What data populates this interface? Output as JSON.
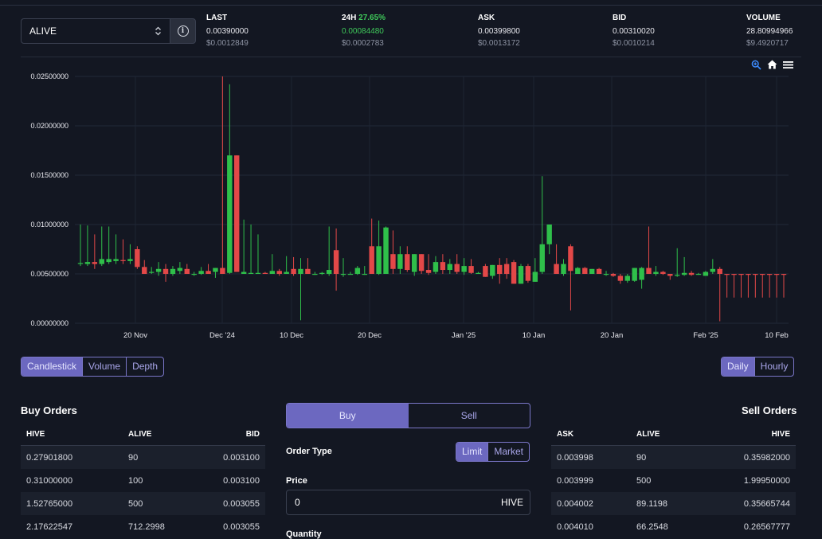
{
  "market": {
    "selected": "ALIVE"
  },
  "stats": {
    "last": {
      "label": "LAST",
      "value": "0.00390000",
      "usd": "$0.0012849"
    },
    "change": {
      "label": "24H",
      "percent": "27.65%",
      "value": "0.00084480",
      "usd": "$0.0002783"
    },
    "ask": {
      "label": "ASK",
      "value": "0.00399800",
      "usd": "$0.0013172"
    },
    "bid": {
      "label": "BID",
      "value": "0.00310020",
      "usd": "$0.0010214"
    },
    "volume": {
      "label": "VOLUME",
      "value": "28.80994966",
      "usd": "$9.4920717"
    }
  },
  "chart_tools": [
    "zoom-icon",
    "home-icon",
    "menu-icon"
  ],
  "chart_data": {
    "type": "candlestick",
    "y_ticks": [
      "0.02500000",
      "0.02000000",
      "0.01500000",
      "0.01000000",
      "0.00500000",
      "0.00000000"
    ],
    "ylim": [
      0,
      0.025
    ],
    "x_ticks": [
      "20 Nov",
      "Dec '24",
      "10 Dec",
      "20 Dec",
      "Jan '25",
      "10 Jan",
      "20 Jan",
      "Feb '25",
      "10 Feb"
    ],
    "up_color": "#2fbf4a",
    "down_color": "#e34848",
    "candles": [
      {
        "o": 0.0061,
        "h": 0.01,
        "l": 0.0058,
        "c": 0.0061
      },
      {
        "o": 0.006,
        "h": 0.0099,
        "l": 0.0058,
        "c": 0.0062
      },
      {
        "o": 0.0062,
        "h": 0.009,
        "l": 0.0055,
        "c": 0.006
      },
      {
        "o": 0.006,
        "h": 0.0098,
        "l": 0.0058,
        "c": 0.0065
      },
      {
        "o": 0.0062,
        "h": 0.0098,
        "l": 0.006,
        "c": 0.0065
      },
      {
        "o": 0.0063,
        "h": 0.009,
        "l": 0.006,
        "c": 0.0065
      },
      {
        "o": 0.0064,
        "h": 0.0085,
        "l": 0.006,
        "c": 0.0063
      },
      {
        "o": 0.0063,
        "h": 0.008,
        "l": 0.006,
        "c": 0.0065
      },
      {
        "o": 0.0075,
        "h": 0.0078,
        "l": 0.0055,
        "c": 0.0057
      },
      {
        "o": 0.0057,
        "h": 0.0064,
        "l": 0.005,
        "c": 0.005
      },
      {
        "o": 0.0052,
        "h": 0.0057,
        "l": 0.005,
        "c": 0.0052
      },
      {
        "o": 0.0052,
        "h": 0.0062,
        "l": 0.0048,
        "c": 0.0055
      },
      {
        "o": 0.0055,
        "h": 0.006,
        "l": 0.0042,
        "c": 0.005
      },
      {
        "o": 0.005,
        "h": 0.0058,
        "l": 0.0048,
        "c": 0.0055
      },
      {
        "o": 0.0053,
        "h": 0.0062,
        "l": 0.005,
        "c": 0.0056
      },
      {
        "o": 0.0055,
        "h": 0.006,
        "l": 0.005,
        "c": 0.005
      },
      {
        "o": 0.005,
        "h": 0.0052,
        "l": 0.0048,
        "c": 0.005
      },
      {
        "o": 0.005,
        "h": 0.0057,
        "l": 0.0049,
        "c": 0.0053
      },
      {
        "o": 0.0053,
        "h": 0.006,
        "l": 0.005,
        "c": 0.005
      },
      {
        "o": 0.0052,
        "h": 0.0056,
        "l": 0.0046,
        "c": 0.0056
      },
      {
        "o": 0.0056,
        "h": 0.025,
        "l": 0.0051,
        "c": 0.005
      },
      {
        "o": 0.0051,
        "h": 0.0242,
        "l": 0.005,
        "c": 0.017
      },
      {
        "o": 0.017,
        "h": 0.017,
        "l": 0.0052,
        "c": 0.0052
      },
      {
        "o": 0.005,
        "h": 0.0105,
        "l": 0.005,
        "c": 0.0052
      },
      {
        "o": 0.005,
        "h": 0.01,
        "l": 0.005,
        "c": 0.0051
      },
      {
        "o": 0.005,
        "h": 0.009,
        "l": 0.005,
        "c": 0.0051
      },
      {
        "o": 0.0051,
        "h": 0.0052,
        "l": 0.005,
        "c": 0.005
      },
      {
        "o": 0.005,
        "h": 0.007,
        "l": 0.005,
        "c": 0.0053
      },
      {
        "o": 0.0053,
        "h": 0.0055,
        "l": 0.0048,
        "c": 0.005
      },
      {
        "o": 0.005,
        "h": 0.0068,
        "l": 0.005,
        "c": 0.0052
      },
      {
        "o": 0.0055,
        "h": 0.0067,
        "l": 0.0048,
        "c": 0.005
      },
      {
        "o": 0.005,
        "h": 0.0066,
        "l": 0.0003,
        "c": 0.0055
      },
      {
        "o": 0.0055,
        "h": 0.0066,
        "l": 0.005,
        "c": 0.005
      },
      {
        "o": 0.005,
        "h": 0.0052,
        "l": 0.0049,
        "c": 0.005
      },
      {
        "o": 0.005,
        "h": 0.0052,
        "l": 0.0049,
        "c": 0.0051
      },
      {
        "o": 0.005,
        "h": 0.0098,
        "l": 0.0048,
        "c": 0.0054
      },
      {
        "o": 0.0074,
        "h": 0.0096,
        "l": 0.0033,
        "c": 0.005
      },
      {
        "o": 0.005,
        "h": 0.0066,
        "l": 0.0047,
        "c": 0.005
      },
      {
        "o": 0.005,
        "h": 0.0052,
        "l": 0.005,
        "c": 0.005
      },
      {
        "o": 0.005,
        "h": 0.0058,
        "l": 0.0049,
        "c": 0.0056
      },
      {
        "o": 0.005,
        "h": 0.0058,
        "l": 0.0049,
        "c": 0.005
      },
      {
        "o": 0.0078,
        "h": 0.0106,
        "l": 0.005,
        "c": 0.005
      },
      {
        "o": 0.005,
        "h": 0.0104,
        "l": 0.0049,
        "c": 0.0078
      },
      {
        "o": 0.005,
        "h": 0.0098,
        "l": 0.005,
        "c": 0.0097
      },
      {
        "o": 0.007,
        "h": 0.0094,
        "l": 0.005,
        "c": 0.0055
      },
      {
        "o": 0.0055,
        "h": 0.0078,
        "l": 0.005,
        "c": 0.007
      },
      {
        "o": 0.007,
        "h": 0.0078,
        "l": 0.0052,
        "c": 0.0054
      },
      {
        "o": 0.0052,
        "h": 0.007,
        "l": 0.0048,
        "c": 0.007
      },
      {
        "o": 0.007,
        "h": 0.007,
        "l": 0.005,
        "c": 0.0053
      },
      {
        "o": 0.0054,
        "h": 0.007,
        "l": 0.0049,
        "c": 0.0051
      },
      {
        "o": 0.0052,
        "h": 0.0068,
        "l": 0.005,
        "c": 0.0062
      },
      {
        "o": 0.0062,
        "h": 0.007,
        "l": 0.005,
        "c": 0.0054
      },
      {
        "o": 0.0054,
        "h": 0.0065,
        "l": 0.005,
        "c": 0.006
      },
      {
        "o": 0.006,
        "h": 0.007,
        "l": 0.005,
        "c": 0.0052
      },
      {
        "o": 0.0052,
        "h": 0.0066,
        "l": 0.0049,
        "c": 0.0058
      },
      {
        "o": 0.0058,
        "h": 0.0065,
        "l": 0.005,
        "c": 0.0051
      },
      {
        "o": 0.005,
        "h": 0.0052,
        "l": 0.005,
        "c": 0.0051
      },
      {
        "o": 0.0058,
        "h": 0.006,
        "l": 0.0047,
        "c": 0.0047
      },
      {
        "o": 0.0048,
        "h": 0.0059,
        "l": 0.0045,
        "c": 0.0059
      },
      {
        "o": 0.0059,
        "h": 0.0066,
        "l": 0.004,
        "c": 0.005
      },
      {
        "o": 0.006,
        "h": 0.0066,
        "l": 0.0045,
        "c": 0.005
      },
      {
        "o": 0.0062,
        "h": 0.0064,
        "l": 0.004,
        "c": 0.004
      },
      {
        "o": 0.004,
        "h": 0.006,
        "l": 0.004,
        "c": 0.0058
      },
      {
        "o": 0.0058,
        "h": 0.006,
        "l": 0.0041,
        "c": 0.0043
      },
      {
        "o": 0.0042,
        "h": 0.0066,
        "l": 0.0042,
        "c": 0.0052
      },
      {
        "o": 0.0052,
        "h": 0.0149,
        "l": 0.005,
        "c": 0.008
      },
      {
        "o": 0.008,
        "h": 0.01,
        "l": 0.007,
        "c": 0.01
      },
      {
        "o": 0.006,
        "h": 0.008,
        "l": 0.005,
        "c": 0.005
      },
      {
        "o": 0.005,
        "h": 0.0065,
        "l": 0.0048,
        "c": 0.006
      },
      {
        "o": 0.0078,
        "h": 0.008,
        "l": 0.0013,
        "c": 0.0053
      },
      {
        "o": 0.005,
        "h": 0.0057,
        "l": 0.005,
        "c": 0.0056
      },
      {
        "o": 0.0056,
        "h": 0.0057,
        "l": 0.005,
        "c": 0.005
      },
      {
        "o": 0.005,
        "h": 0.0055,
        "l": 0.005,
        "c": 0.0055
      },
      {
        "o": 0.0055,
        "h": 0.0056,
        "l": 0.005,
        "c": 0.005
      },
      {
        "o": 0.005,
        "h": 0.0053,
        "l": 0.0048,
        "c": 0.005
      },
      {
        "o": 0.005,
        "h": 0.0051,
        "l": 0.0047,
        "c": 0.0048
      },
      {
        "o": 0.0048,
        "h": 0.005,
        "l": 0.004,
        "c": 0.0043
      },
      {
        "o": 0.0043,
        "h": 0.005,
        "l": 0.0041,
        "c": 0.0048
      },
      {
        "o": 0.0043,
        "h": 0.0056,
        "l": 0.0042,
        "c": 0.0056
      },
      {
        "o": 0.0044,
        "h": 0.0057,
        "l": 0.0035,
        "c": 0.0056
      },
      {
        "o": 0.0056,
        "h": 0.0098,
        "l": 0.005,
        "c": 0.005
      },
      {
        "o": 0.005,
        "h": 0.0058,
        "l": 0.0048,
        "c": 0.0052
      },
      {
        "o": 0.0052,
        "h": 0.0053,
        "l": 0.0049,
        "c": 0.005
      },
      {
        "o": 0.005,
        "h": 0.005,
        "l": 0.0044,
        "c": 0.0048
      },
      {
        "o": 0.0048,
        "h": 0.0076,
        "l": 0.0047,
        "c": 0.0049
      },
      {
        "o": 0.0049,
        "h": 0.0067,
        "l": 0.0048,
        "c": 0.0051
      },
      {
        "o": 0.0051,
        "h": 0.0053,
        "l": 0.0048,
        "c": 0.0049
      },
      {
        "o": 0.005,
        "h": 0.0051,
        "l": 0.0049,
        "c": 0.005
      },
      {
        "o": 0.0048,
        "h": 0.0053,
        "l": 0.0048,
        "c": 0.0052
      },
      {
        "o": 0.0052,
        "h": 0.0065,
        "l": 0.005,
        "c": 0.0055
      },
      {
        "o": 0.0055,
        "h": 0.0057,
        "l": 0.0002,
        "c": 0.005
      },
      {
        "o": 0.005,
        "h": 0.005,
        "l": 0.0026,
        "c": 0.0049
      },
      {
        "o": 0.005,
        "h": 0.005,
        "l": 0.0026,
        "c": 0.0049
      },
      {
        "o": 0.005,
        "h": 0.005,
        "l": 0.0026,
        "c": 0.0049
      },
      {
        "o": 0.005,
        "h": 0.005,
        "l": 0.0026,
        "c": 0.0049
      },
      {
        "o": 0.005,
        "h": 0.005,
        "l": 0.0026,
        "c": 0.0049
      },
      {
        "o": 0.005,
        "h": 0.005,
        "l": 0.0026,
        "c": 0.0049
      },
      {
        "o": 0.005,
        "h": 0.005,
        "l": 0.0026,
        "c": 0.0049
      },
      {
        "o": 0.005,
        "h": 0.005,
        "l": 0.0026,
        "c": 0.0049
      },
      {
        "o": 0.005,
        "h": 0.005,
        "l": 0.0026,
        "c": 0.0049
      }
    ]
  },
  "chart_type_buttons": {
    "candlestick": "Candlestick",
    "volume": "Volume",
    "depth": "Depth"
  },
  "interval_buttons": {
    "daily": "Daily",
    "hourly": "Hourly"
  },
  "buy_orders": {
    "title": "Buy Orders",
    "headers": [
      "HIVE",
      "ALIVE",
      "BID"
    ],
    "rows": [
      [
        "0.27901800",
        "90",
        "0.003100"
      ],
      [
        "0.31000000",
        "100",
        "0.003100"
      ],
      [
        "1.52765000",
        "500",
        "0.003055"
      ],
      [
        "2.17622547",
        "712.2998",
        "0.003055"
      ]
    ]
  },
  "sell_orders": {
    "title": "Sell Orders",
    "headers": [
      "ASK",
      "ALIVE",
      "HIVE"
    ],
    "rows": [
      [
        "0.003998",
        "90",
        "0.35982000"
      ],
      [
        "0.003999",
        "500",
        "1.99950000"
      ],
      [
        "0.004002",
        "89.1198",
        "0.35665744"
      ],
      [
        "0.004010",
        "66.2548",
        "0.26567777"
      ]
    ]
  },
  "trade_form": {
    "buy_tab": "Buy",
    "sell_tab": "Sell",
    "order_type_label": "Order Type",
    "limit": "Limit",
    "market": "Market",
    "price_label": "Price",
    "price_value": "0",
    "price_unit": "HIVE",
    "quantity_label": "Quantity"
  }
}
